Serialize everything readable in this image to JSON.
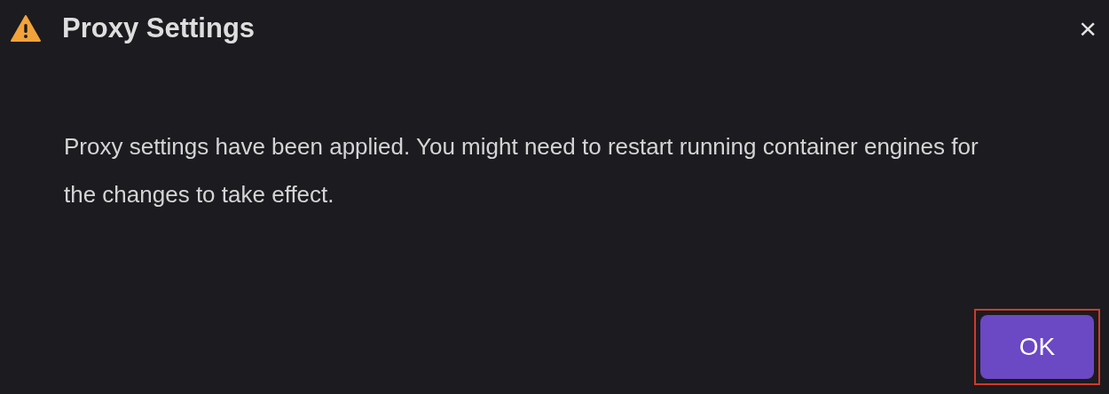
{
  "dialog": {
    "title": "Proxy Settings",
    "close": "×",
    "message": "Proxy settings have been applied. You might need to restart running container engines for the changes to take effect.",
    "buttons": [
      {
        "label": "OK",
        "highlighted": true
      }
    ]
  }
}
